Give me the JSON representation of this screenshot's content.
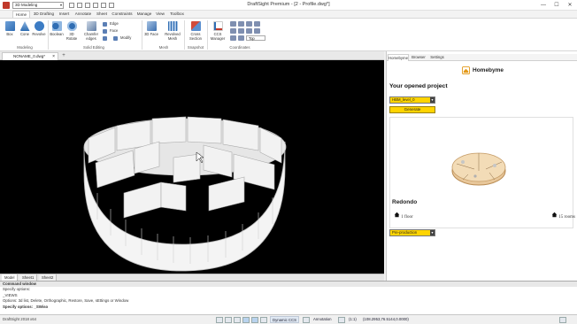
{
  "titlebar": {
    "workspace": "3D Modeling",
    "title": "DraftSight Premium - [2 - Profile.dwg*]",
    "min": "—",
    "max": "☐",
    "close": "✕"
  },
  "ribbon_tabs": [
    "Home",
    "3D Drafting",
    "Insert",
    "Annotate",
    "Sheet",
    "Constraints",
    "Manage",
    "View",
    "Toolbox"
  ],
  "ribbon": {
    "modeling": {
      "label": "Modeling",
      "buttons": [
        "Box",
        "Cone",
        "Revolve"
      ]
    },
    "solid_editing": {
      "label": "Solid Editing",
      "buttons": [
        "Boolean",
        "3D Rotate",
        "Chamfer edges"
      ],
      "small": [
        "Edge",
        "Face",
        "Modify"
      ]
    },
    "mesh": {
      "label": "Mesh",
      "buttons": [
        "3D Face",
        "Revolved Mesh"
      ]
    },
    "snapshot": {
      "label": "Snapshot",
      "buttons": [
        "Cross Section"
      ]
    },
    "coordinates": {
      "label": "Coordinates",
      "buttons": [
        "CCS Manager"
      ],
      "view_select": "Top"
    }
  },
  "doc_tab": {
    "label": "NONAME_0.dwg*",
    "close": "×",
    "add": "+"
  },
  "model_tabs": [
    "Model",
    "Sheet1",
    "Sheet2"
  ],
  "panel": {
    "tabs": [
      "Homebyme",
      "Browser",
      "Settings"
    ],
    "brand": "Homebyme",
    "section_title": "Your opened project",
    "project_select": "HBM_level_0",
    "generate_label": "Generate",
    "project_name": "Redondo",
    "floors": "1 floor",
    "rooms": "15 rooms",
    "state_select": "Pre-production"
  },
  "command": {
    "title": "Command window",
    "lines": [
      "Specify options:",
      "_VIEWS",
      "Options: 3d list, Delete, Orthographic, Restore, Save, sEttings or Window",
      "Specify options: _SWiso"
    ]
  },
  "statusbar": {
    "version": "DraftSight 2018 x64",
    "dynamic_ccs": "Dynamic CCS",
    "annotation": "Annotation",
    "scale": "(1:1)",
    "coords": "(108.2953,76.5144,0.0000)"
  },
  "colors": {
    "accent_yellow": "#ffd400",
    "viewport_bg": "#000000",
    "ribbon_blue": "#2f6db3"
  }
}
